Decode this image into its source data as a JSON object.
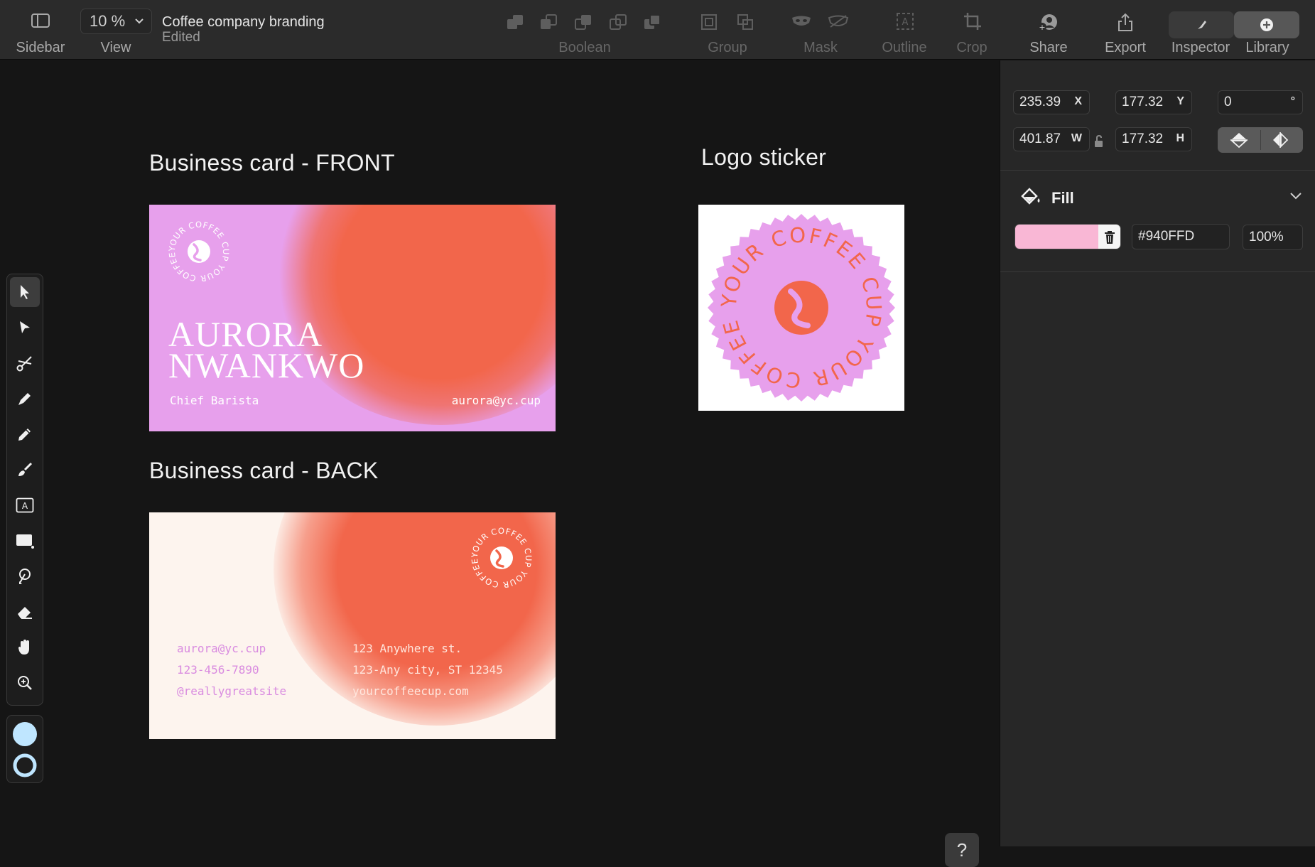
{
  "toolbar": {
    "sidebar_label": "Sidebar",
    "view_label": "View",
    "zoom_value": "10 %",
    "doc_title": "Coffee company branding",
    "doc_status": "Edited",
    "boolean_label": "Boolean",
    "group_label": "Group",
    "mask_label": "Mask",
    "outline_label": "Outline",
    "crop_label": "Crop",
    "share_label": "Share",
    "export_label": "Export",
    "inspector_label": "Inspector",
    "library_label": "Library"
  },
  "canvas": {
    "front_title": "Business card - FRONT",
    "back_title": "Business card - BACK",
    "sticker_title": "Logo sticker",
    "front_card": {
      "logo_ring_text": "YOUR COFFEE CUP YOUR COFFEE CUP",
      "name_line1": "AURORA",
      "name_line2": "NWANKWO",
      "role": "Chief Barista",
      "email": "aurora@yc.cup"
    },
    "back_card": {
      "logo_ring_text": "YOUR COFFEE CUP YOUR COFFEE CUP",
      "email": "aurora@yc.cup",
      "phone": "123-456-7890",
      "social": "@reallygreatsite",
      "address1": "123 Anywhere st.",
      "address2": "123-Any city, ST 12345",
      "website": "yourcoffeecup.com"
    },
    "sticker_ring_text": "YOUR COFFEE CUP YOUR COFFEE CUP",
    "help_label": "?"
  },
  "colors": {
    "front_bg": "#e7a0ec",
    "orange": "#f2664b",
    "back_bg": "#fdf4ee",
    "back_text_left": "#d98be0",
    "back_text_right": "#ffe6dd",
    "fill_swatch": "#f9b7d5",
    "fill_color_indicator": "#bfe6ff"
  },
  "inspector": {
    "x_value": "235.39",
    "x_label": "X",
    "y_value": "177.32",
    "y_label": "Y",
    "rotation_value": "0",
    "rotation_unit": "°",
    "w_value": "401.87",
    "w_label": "W",
    "h_value": "177.32",
    "h_label": "H",
    "fill_label": "Fill",
    "fill_hex": "#940FFD",
    "fill_opacity": "100%"
  }
}
